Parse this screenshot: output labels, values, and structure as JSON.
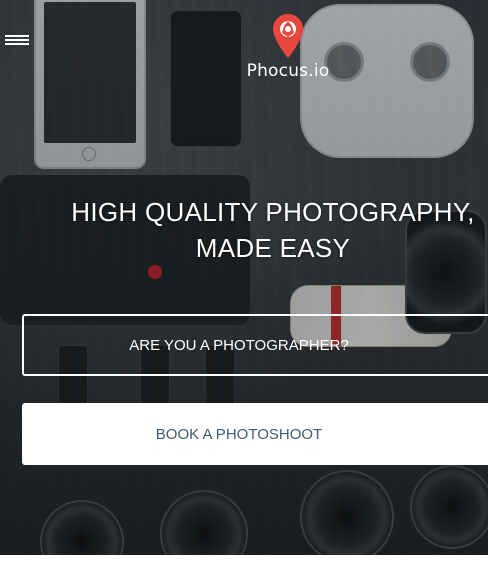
{
  "header": {
    "menu_icon": "hamburger-menu-icon",
    "logo_icon": "map-pin-camera-icon",
    "brand_name": "Phocus.io"
  },
  "hero": {
    "headline_line1": "HIGH QUALITY PHOTOGRAPHY,",
    "headline_line2": "MADE EASY",
    "photographer_button_label": "ARE YOU A PHOTOGRAPHER?",
    "book_button_label": "BOOK A PHOTOSHOOT"
  },
  "colors": {
    "brand_red": "#e8473e",
    "button_text": "#3e5c70",
    "white": "#ffffff"
  }
}
